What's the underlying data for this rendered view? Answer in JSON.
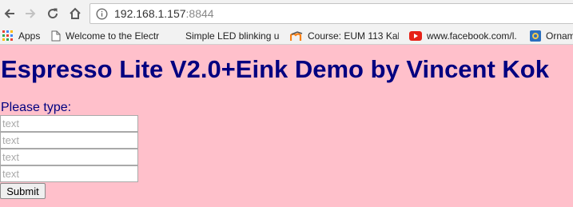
{
  "browser": {
    "url_host": "192.168.1.157",
    "url_port": ":8844",
    "icons": [
      "back-arrow-icon",
      "forward-arrow-icon",
      "reload-icon",
      "home-icon",
      "info-icon"
    ]
  },
  "bookmarks": [
    {
      "label": "Apps",
      "icon": "apps-grid-icon"
    },
    {
      "label": "Welcome to the Electr",
      "icon": "page-icon"
    },
    {
      "label": "Simple LED blinking u",
      "icon": "none"
    },
    {
      "label": "Course: EUM 113 Kalk",
      "icon": "moodle-icon"
    },
    {
      "label": "www.facebook.com/l.",
      "icon": "youtube-icon"
    },
    {
      "label": "Ornam",
      "icon": "site-icon"
    }
  ],
  "page": {
    "title": "Espresso Lite V2.0+Eink Demo by Vincent Kok",
    "prompt": "Please type:",
    "inputs": [
      {
        "value": "",
        "placeholder": "text"
      },
      {
        "value": "",
        "placeholder": "text"
      },
      {
        "value": "",
        "placeholder": "text"
      },
      {
        "value": "",
        "placeholder": "text"
      }
    ],
    "submit_label": "Submit"
  },
  "colors": {
    "background": "#ffc0cb",
    "heading": "#000080",
    "chrome": "#f2f2f2"
  }
}
